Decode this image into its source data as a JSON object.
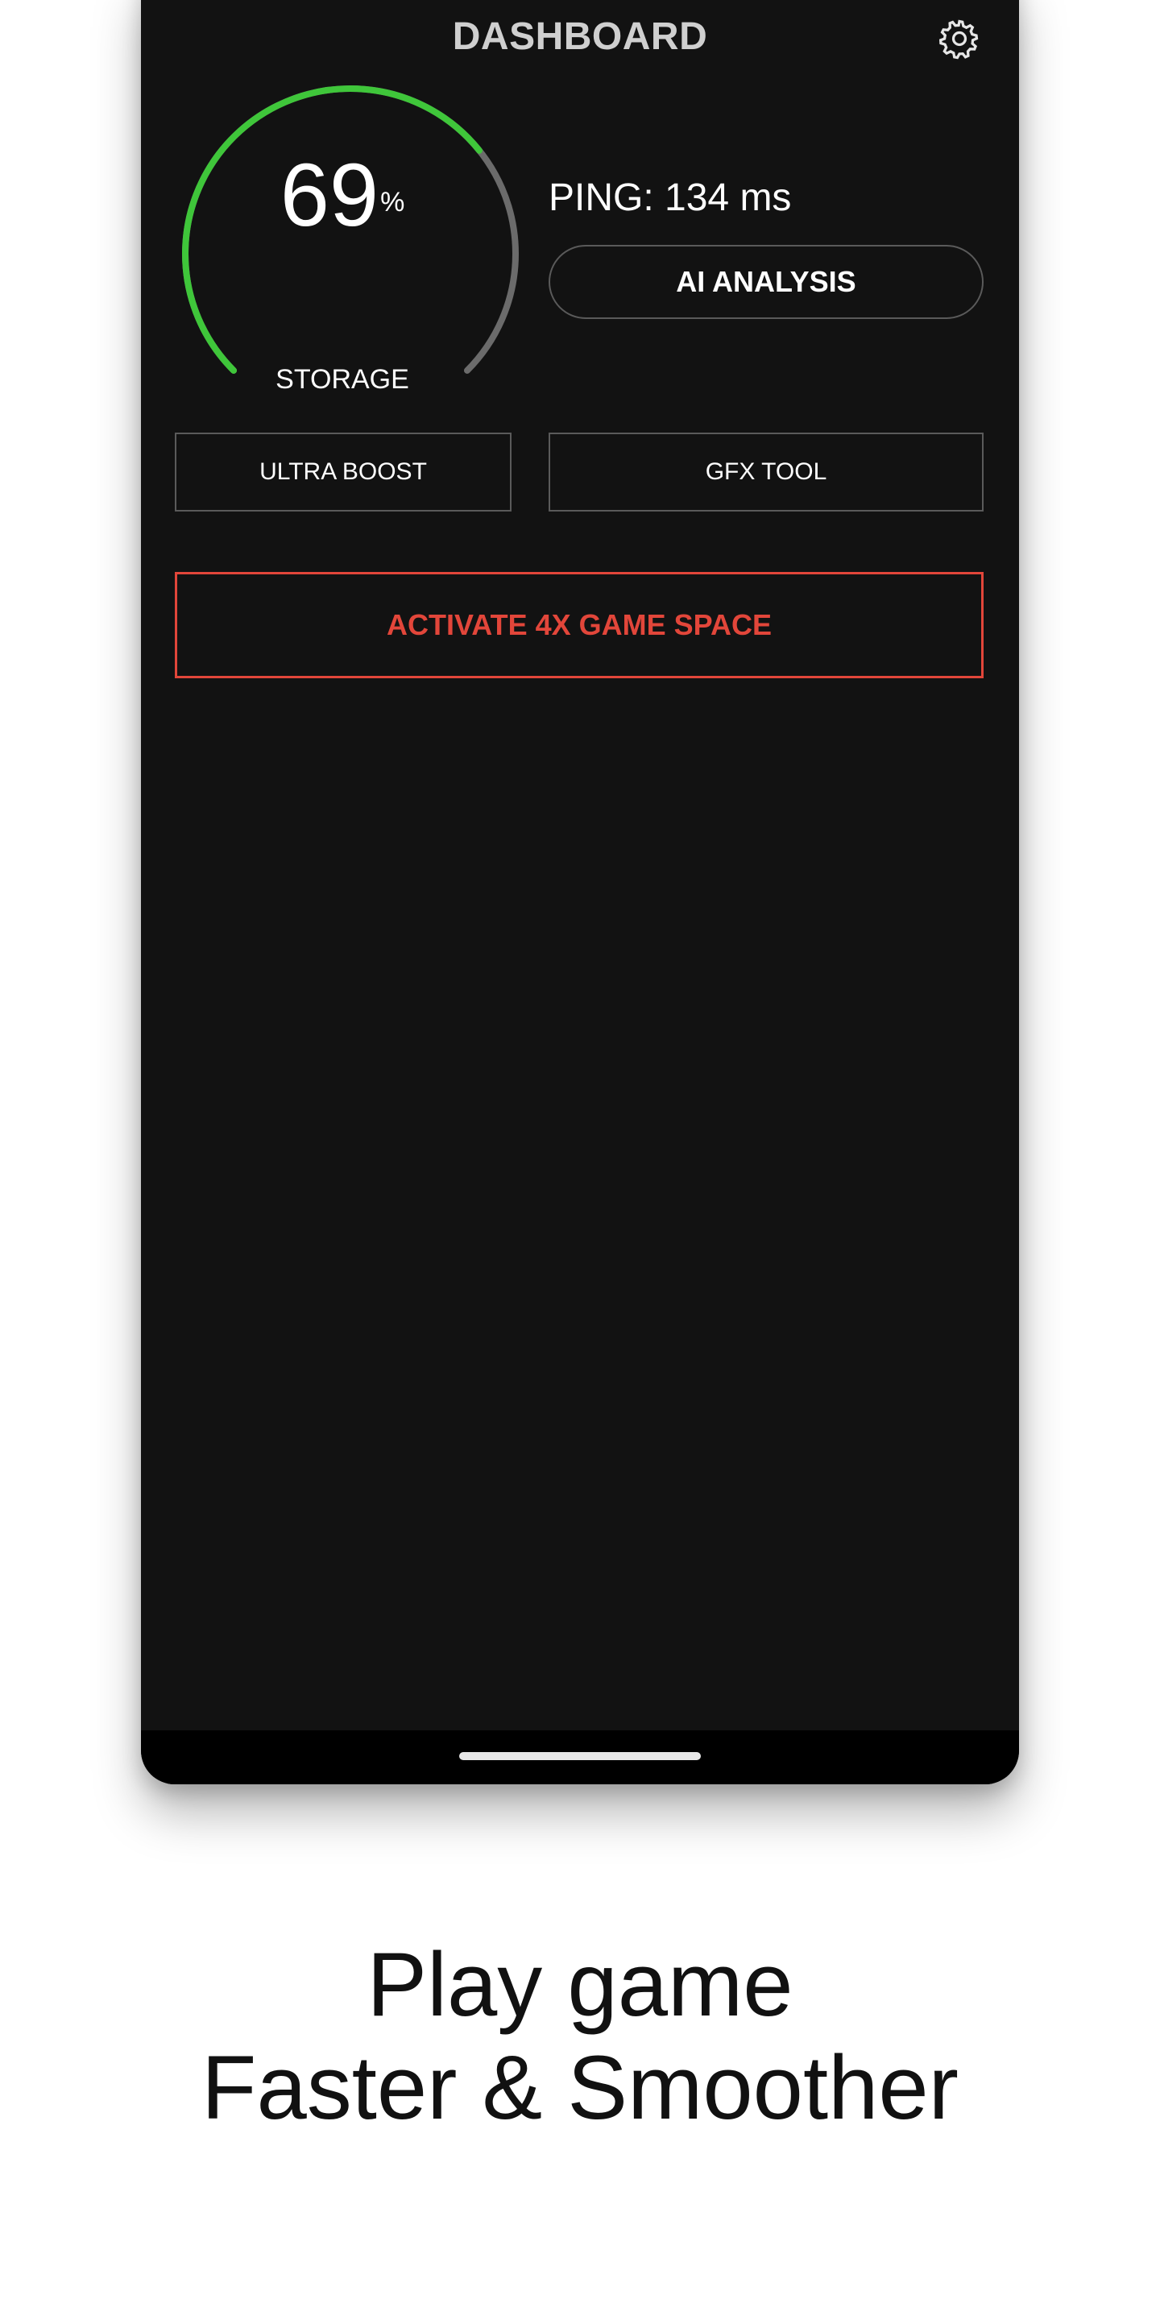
{
  "header": {
    "title": "DASHBOARD",
    "settings_icon": "gear-icon"
  },
  "storage_gauge": {
    "value": "69",
    "unit": "%",
    "label": "STORAGE",
    "fraction": 0.69,
    "fill_color": "#3fc63a",
    "track_color": "#6b6b6b"
  },
  "ping": {
    "text": "PING: 134 ms"
  },
  "buttons": {
    "ai_analysis": "AI ANALYSIS",
    "ultra_boost": "ULTRA BOOST",
    "gfx_tool": "GFX TOOL",
    "activate": "ACTIVATE 4X GAME SPACE"
  },
  "colors": {
    "background": "#121212",
    "accent_red": "#e2463a",
    "accent_green": "#3fc63a"
  },
  "tagline": {
    "line1": "Play game",
    "line2": "Faster & Smoother"
  }
}
